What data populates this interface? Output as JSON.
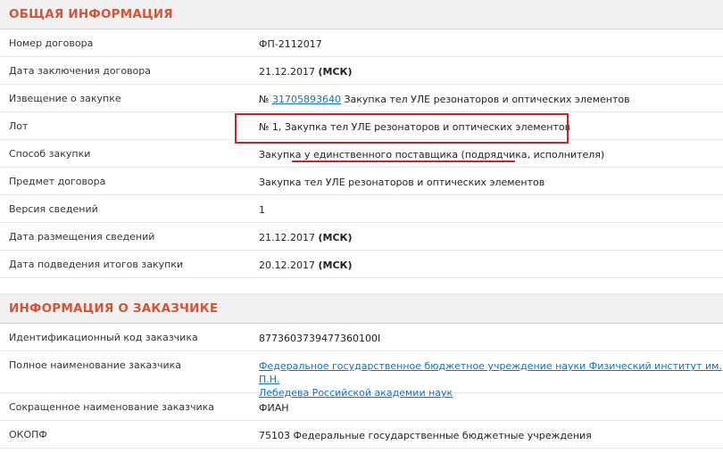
{
  "general": {
    "title": "ОБЩАЯ ИНФОРМАЦИЯ",
    "rows": [
      {
        "label": "Номер договора",
        "value": "ФП-2112017"
      },
      {
        "label": "Дата заключения договора",
        "value": "21.12.2017",
        "suffix": "(МСК)"
      },
      {
        "label": "Извещение о закупке",
        "prefix": "№",
        "link": "31705893640",
        "value": "Закупка тел УЛЕ резонаторов и оптических элементов"
      },
      {
        "label": "Лот",
        "value": "№ 1, Закупка тел УЛЕ резонаторов и оптических элементов"
      },
      {
        "label": "Способ закупки",
        "value": "Закупка у единственного поставщика (подрядчика, исполнителя)"
      },
      {
        "label": "Предмет договора",
        "value": "Закупка тел УЛЕ резонаторов и оптических элементов"
      },
      {
        "label": "Версия сведений",
        "value": "1"
      },
      {
        "label": "Дата размещения сведений",
        "value": "21.12.2017",
        "suffix": "(МСК)"
      },
      {
        "label": "Дата подведения итогов закупки",
        "value": "20.12.2017",
        "suffix": "(МСК)"
      }
    ]
  },
  "customer": {
    "title": "ИНФОРМАЦИЯ О ЗАКАЗЧИКЕ",
    "rows": [
      {
        "label": "Идентификационный код заказчика",
        "value": "8773603739477360100I"
      },
      {
        "label": "Полное наименование заказчика",
        "link_line1": "Федеральное государственное бюджетное учреждение науки Физический институт им. П.Н.",
        "link_line2": "Лебедева Российской академии наук"
      },
      {
        "label": "Сокращенное наименование заказчика",
        "value": "ФИАН"
      },
      {
        "label": "ОКОПФ",
        "value": "75103 Федеральные государственные бюджетные учреждения"
      }
    ]
  },
  "annotations": {
    "highlight_color": "#c0272d"
  }
}
